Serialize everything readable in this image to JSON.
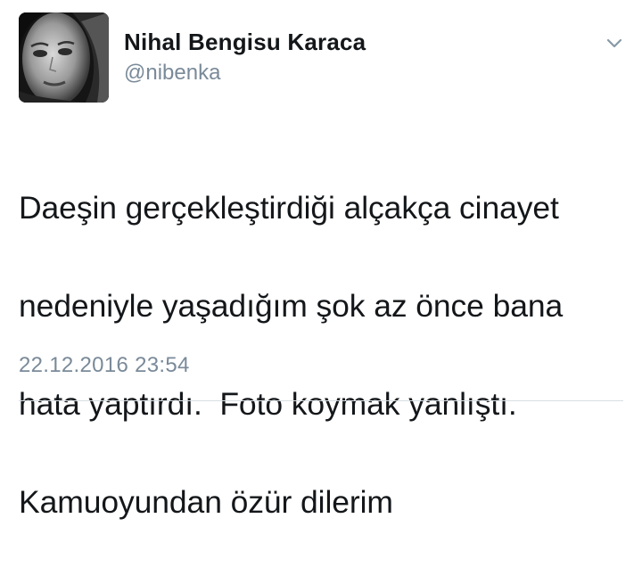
{
  "tweet": {
    "display_name": "Nihal Bengisu Karaca",
    "handle": "@nibenka",
    "text_lines": [
      "Daeşin gerçekleştirdiği alçakça cinayet",
      "nedeniyle yaşadığım şok az önce bana",
      "hata yaptırdı.  Foto koymak yanlıştı.",
      "Kamuoyundan özür dilerim"
    ],
    "timestamp": "22.12.2016 23:54",
    "avatar_icon": "profile-photo",
    "menu_icon": "chevron-down-icon"
  }
}
